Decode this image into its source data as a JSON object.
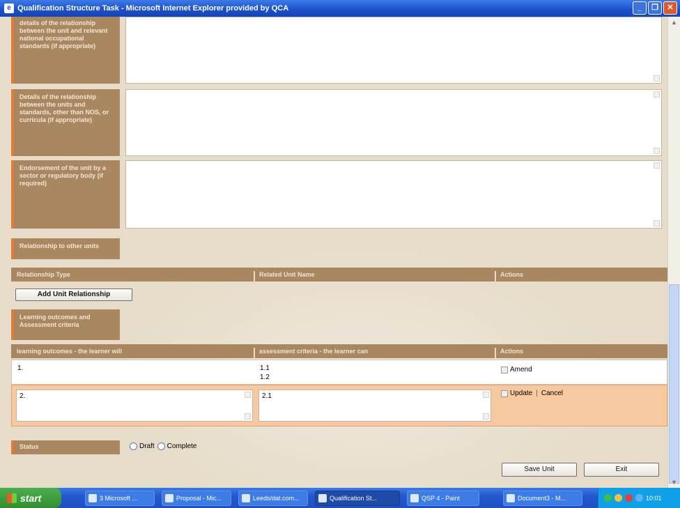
{
  "window": {
    "title": "Qualification Structure Task - Microsoft Internet Explorer provided by QCA",
    "buttons": [
      "_",
      "❐",
      "✕"
    ]
  },
  "fields": {
    "relationship_nos_label": "details of the relationship between the unit and relevant national occupational standards (if appropriate)",
    "relationship_other_label": "Details of the relationship between the units and standards, other than NOS, or curricula (if appropriate)",
    "endorsement_label": "Endorsement of the unit by a sector or regulatory body (if required)",
    "relationship_units_label": "Relationship to other units",
    "learning_outcomes_label": "Learning outcomes and Assessment criteria",
    "status_label": "Status"
  },
  "relationships_table": {
    "columns": [
      "Relationship Type",
      "Related Unit Name",
      "Actions"
    ],
    "add_button": "Add Unit Relationship"
  },
  "outcomes_table": {
    "columns": [
      "learning outcomes - the learner will",
      "assessment criteria - the learner can",
      "Actions"
    ],
    "row1": {
      "outcome": "1.",
      "criteria_a": "1.1",
      "criteria_b": "1.2",
      "action": "Amend"
    },
    "row2": {
      "outcome": "2.",
      "criteria": "2.1",
      "update": "Update",
      "separator": "|",
      "cancel": "Cancel"
    }
  },
  "status": {
    "draft": "Draft",
    "complete": "Complete"
  },
  "footer": {
    "save": "Save Unit",
    "exit": "Exit"
  },
  "taskbar": {
    "start": "start",
    "tasks": [
      "3 Microsoft ...",
      "Proposal - Mic...",
      "Leeds/dat.com...",
      "Qualification St...",
      "QSP 4 - Paint",
      "Document3 - M..."
    ],
    "clock": "10:01"
  }
}
